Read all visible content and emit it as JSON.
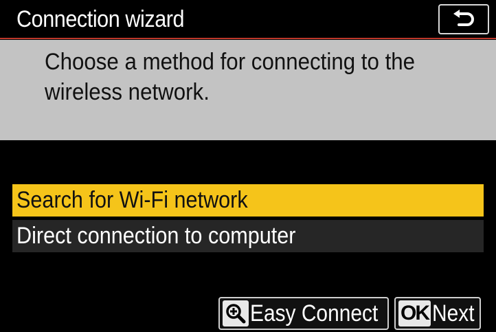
{
  "header": {
    "title": "Connection wizard",
    "back_icon": "return-arrow-icon"
  },
  "prompt": {
    "text": "Choose a method for connecting to the\nwireless network."
  },
  "menu": {
    "items": [
      {
        "label": "Search for Wi-Fi network",
        "selected": true
      },
      {
        "label": "Direct connection to computer",
        "selected": false
      }
    ]
  },
  "footer": {
    "easy_connect": {
      "icon": "zoom-in-icon",
      "label": "Easy Connect"
    },
    "next": {
      "icon_text": "OK",
      "label": "Next"
    }
  },
  "colors": {
    "background": "#000000",
    "prompt_panel": "#c3c3c3",
    "selection_highlight": "#f5c41a",
    "unselected_item": "#262626",
    "header_rule": "#c0392b"
  }
}
